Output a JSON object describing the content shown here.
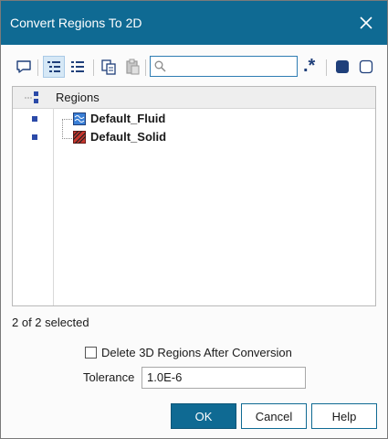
{
  "window": {
    "title": "Convert Regions To 2D",
    "accent": "#0f6a93"
  },
  "toolbar": {
    "regex_label": ".*",
    "search": {
      "value": "",
      "placeholder": ""
    },
    "icons": [
      "comment-icon",
      "tree-view-icon",
      "list-view-icon",
      "copy-icon",
      "paste-icon",
      "search-icon",
      "select-all-icon",
      "select-none-icon"
    ]
  },
  "tree": {
    "header": "Regions",
    "items": [
      {
        "label": "Default_Fluid",
        "icon": "fluid-region-icon",
        "selected": true
      },
      {
        "label": "Default_Solid",
        "icon": "solid-region-icon",
        "selected": true
      }
    ]
  },
  "status": "2 of 2 selected",
  "options": {
    "delete_3d_label": "Delete 3D Regions After Conversion",
    "delete_3d_checked": false,
    "tolerance_label": "Tolerance",
    "tolerance_value": "1.0E-6"
  },
  "buttons": {
    "ok": "OK",
    "cancel": "Cancel",
    "help": "Help"
  }
}
